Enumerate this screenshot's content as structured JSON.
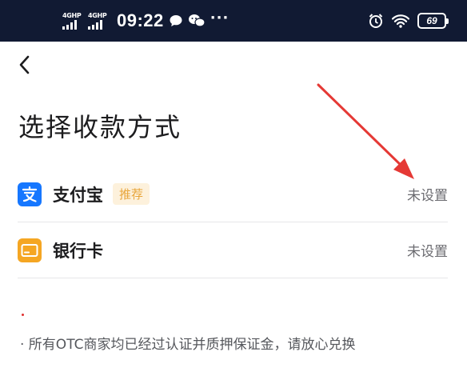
{
  "status_bar": {
    "networks": [
      "4GHP",
      "4GHP"
    ],
    "time": "09:22",
    "more": "···",
    "battery": "69"
  },
  "page": {
    "title": "选择收款方式"
  },
  "methods": [
    {
      "name": "支付宝",
      "badge": "推荐",
      "status": "未设置"
    },
    {
      "name": "银行卡",
      "status": "未设置"
    }
  ],
  "note": "· 所有OTC商家均已经过认证并质押保证金，请放心兑换",
  "colors": {
    "status_bar_bg": "#111a33",
    "alipay_blue": "#1677ff",
    "bankcard_orange": "#f5a623",
    "badge_text": "#e8a53a",
    "badge_bg": "#fdf1dc",
    "annotation_arrow": "#e53935"
  }
}
